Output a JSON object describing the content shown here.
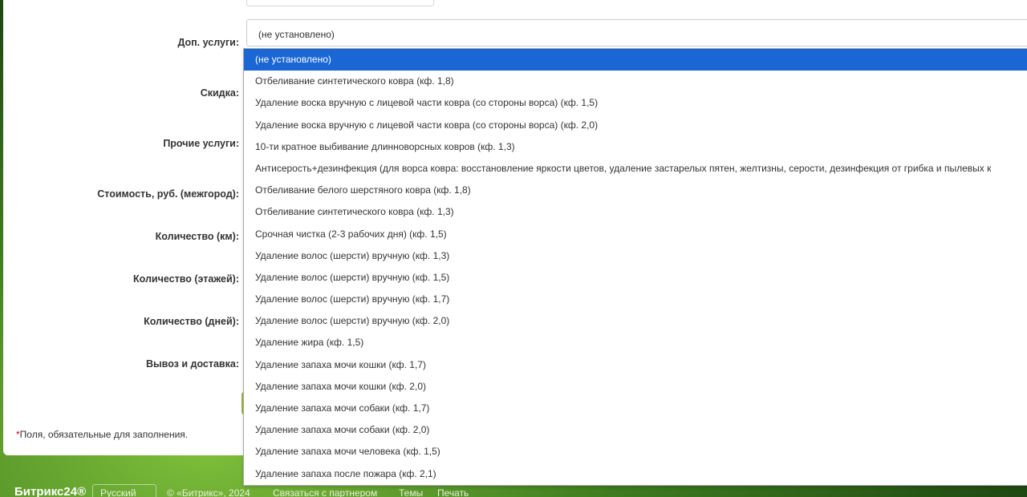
{
  "form": {
    "labels": [
      "Доп. услуги:",
      "Скидка:",
      "Прочие услуги:",
      "Стоимость, руб. (межгород):",
      "Количество (км):",
      "Количество (этажей):",
      "Количество (дней):",
      "Вывоз и доставка:"
    ],
    "select_value": "(не установлено)",
    "footnote_star": "*",
    "footnote_text": "Поля, обязательные для заполнения."
  },
  "dropdown": {
    "selected_index": 0,
    "options": [
      "(не установлено)",
      "Отбеливание синтетического ковра (кф. 1,8)",
      "Удаление воска вручную с лицевой части ковра   (со стороны ворса)   (кф. 1,5)",
      "Удаление воска вручную с лицевой части ковра   (со стороны ворса)   (кф. 2,0)",
      "10-ти кратное выбивание длинноворсных ковров (кф. 1,3)",
      "Антисерость+дезинфекция  (для ворса ковра: восстановление яркости цветов, удаление застарелых пятен, желтизны, серости, дезинфекция от грибка и пылевых к",
      "Отбеливание белого шерстяного ковра (кф. 1,8)",
      "Отбеливание синтетического ковра (кф. 1,3)",
      "Срочная чистка  (2-3 рабочих дня)   (кф. 1,5)",
      "Удаление волос  (шерсти)  вручную (кф. 1,3)",
      "Удаление волос  (шерсти)  вручную (кф. 1,5)",
      "Удаление волос  (шерсти)  вручную (кф. 1,7)",
      "Удаление волос  (шерсти)  вручную (кф. 2,0)",
      "Удаление жира (кф. 1,5)",
      "Удаление запаха мочи кошки (кф. 1,7)",
      "Удаление запаха мочи кошки (кф. 2,0)",
      "Удаление запаха мочи собаки (кф. 1,7)",
      "Удаление запаха мочи собаки (кф. 2,0)",
      "Удаление запаха мочи человека (кф. 1,5)",
      "Удаление запаха после пожара (кф. 2,1)"
    ]
  },
  "footer": {
    "logo": "Битрикс24®",
    "language": "Русский",
    "copyright": "© «Битрикс», 2024",
    "partner_link": "Связаться с партнером",
    "themes_link": "Темы",
    "print_link": "Печать"
  }
}
